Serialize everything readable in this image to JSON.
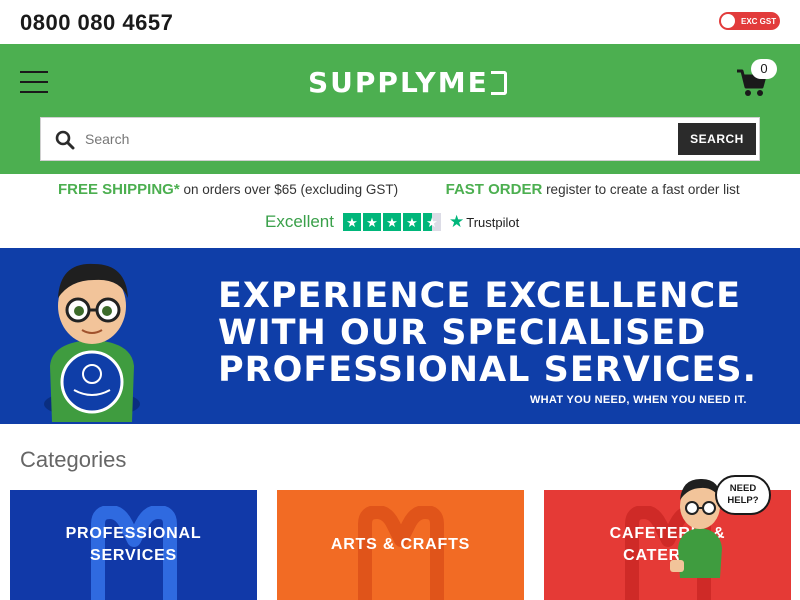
{
  "topbar": {
    "phone": "0800 080 4657",
    "gst_toggle_label": "EXC GST"
  },
  "header": {
    "logo_text": "SUPPLYME",
    "cart_count": "0"
  },
  "search": {
    "placeholder": "Search",
    "button_label": "SEARCH"
  },
  "promo": {
    "shipping_highlight": "FREE SHIPPING*",
    "shipping_text": "on orders over $65 (excluding GST)",
    "fast_order_highlight": "FAST ORDER",
    "fast_order_text": "register to create a fast order list",
    "trust_rating": "Excellent",
    "trust_brand": "Trustpilot",
    "trust_stars": 4.5
  },
  "banner": {
    "line1": "EXPERIENCE EXCELLENCE",
    "line2": "WITH OUR SPECIALISED",
    "line3": "PROFESSIONAL SERVICES.",
    "tagline": "WHAT YOU NEED, WHEN YOU NEED IT."
  },
  "categories": {
    "title": "Categories",
    "items": [
      {
        "label_line1": "PROFESSIONAL",
        "label_line2": "SERVICES",
        "color": "#1139a8"
      },
      {
        "label_line1": "ARTS & CRAFTS",
        "label_line2": "",
        "color": "#f26b24"
      },
      {
        "label_line1": "CAFETERIA &",
        "label_line2": "CATERING",
        "color": "#e53a36"
      }
    ]
  },
  "help": {
    "line1": "NEED",
    "line2": "HELP?"
  },
  "colors": {
    "brand_green": "#4caf50",
    "banner_blue": "#0f3ea8",
    "trustpilot_green": "#00b67a"
  }
}
